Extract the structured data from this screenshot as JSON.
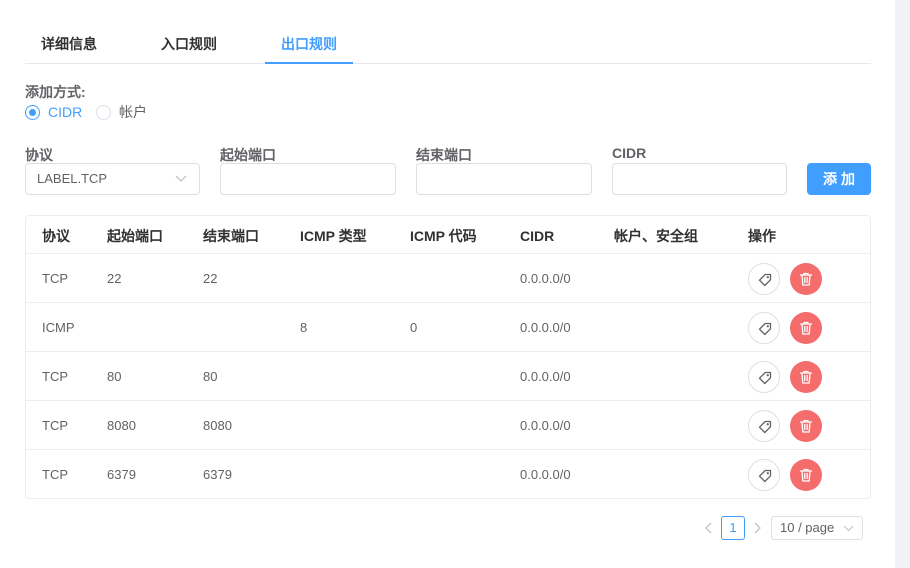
{
  "tabs": [
    {
      "label": "详细信息"
    },
    {
      "label": "入口规则"
    },
    {
      "label": "出口规则"
    }
  ],
  "active_tab": "出口规则",
  "add_method": {
    "label": "添加方式:",
    "options": [
      {
        "label": "CIDR",
        "checked": true
      },
      {
        "label": "帐户",
        "checked": false
      }
    ]
  },
  "form": {
    "protocol_label": "协议",
    "protocol_value": "LABEL.TCP",
    "start_port_label": "起始端口",
    "end_port_label": "结束端口",
    "cidr_label": "CIDR",
    "add_button": "添加"
  },
  "table": {
    "headers": [
      "协议",
      "起始端口",
      "结束端口",
      "ICMP 类型",
      "ICMP 代码",
      "CIDR",
      "帐户、安全组",
      "操作"
    ],
    "rows": [
      {
        "protocol": "TCP",
        "start_port": "22",
        "end_port": "22",
        "icmp_type": "",
        "icmp_code": "",
        "cidr": "0.0.0.0/0",
        "account": ""
      },
      {
        "protocol": "ICMP",
        "start_port": "",
        "end_port": "",
        "icmp_type": "8",
        "icmp_code": "0",
        "cidr": "0.0.0.0/0",
        "account": ""
      },
      {
        "protocol": "TCP",
        "start_port": "80",
        "end_port": "80",
        "icmp_type": "",
        "icmp_code": "",
        "cidr": "0.0.0.0/0",
        "account": ""
      },
      {
        "protocol": "TCP",
        "start_port": "8080",
        "end_port": "8080",
        "icmp_type": "",
        "icmp_code": "",
        "cidr": "0.0.0.0/0",
        "account": ""
      },
      {
        "protocol": "TCP",
        "start_port": "6379",
        "end_port": "6379",
        "icmp_type": "",
        "icmp_code": "",
        "cidr": "0.0.0.0/0",
        "account": ""
      }
    ],
    "row_actions": {
      "edit_icon": "tag-icon",
      "delete_icon": "trash-icon"
    }
  },
  "pagination": {
    "current_page": "1",
    "page_size": "10 / page"
  },
  "colors": {
    "primary": "#409eff",
    "danger": "#f56c6c"
  }
}
